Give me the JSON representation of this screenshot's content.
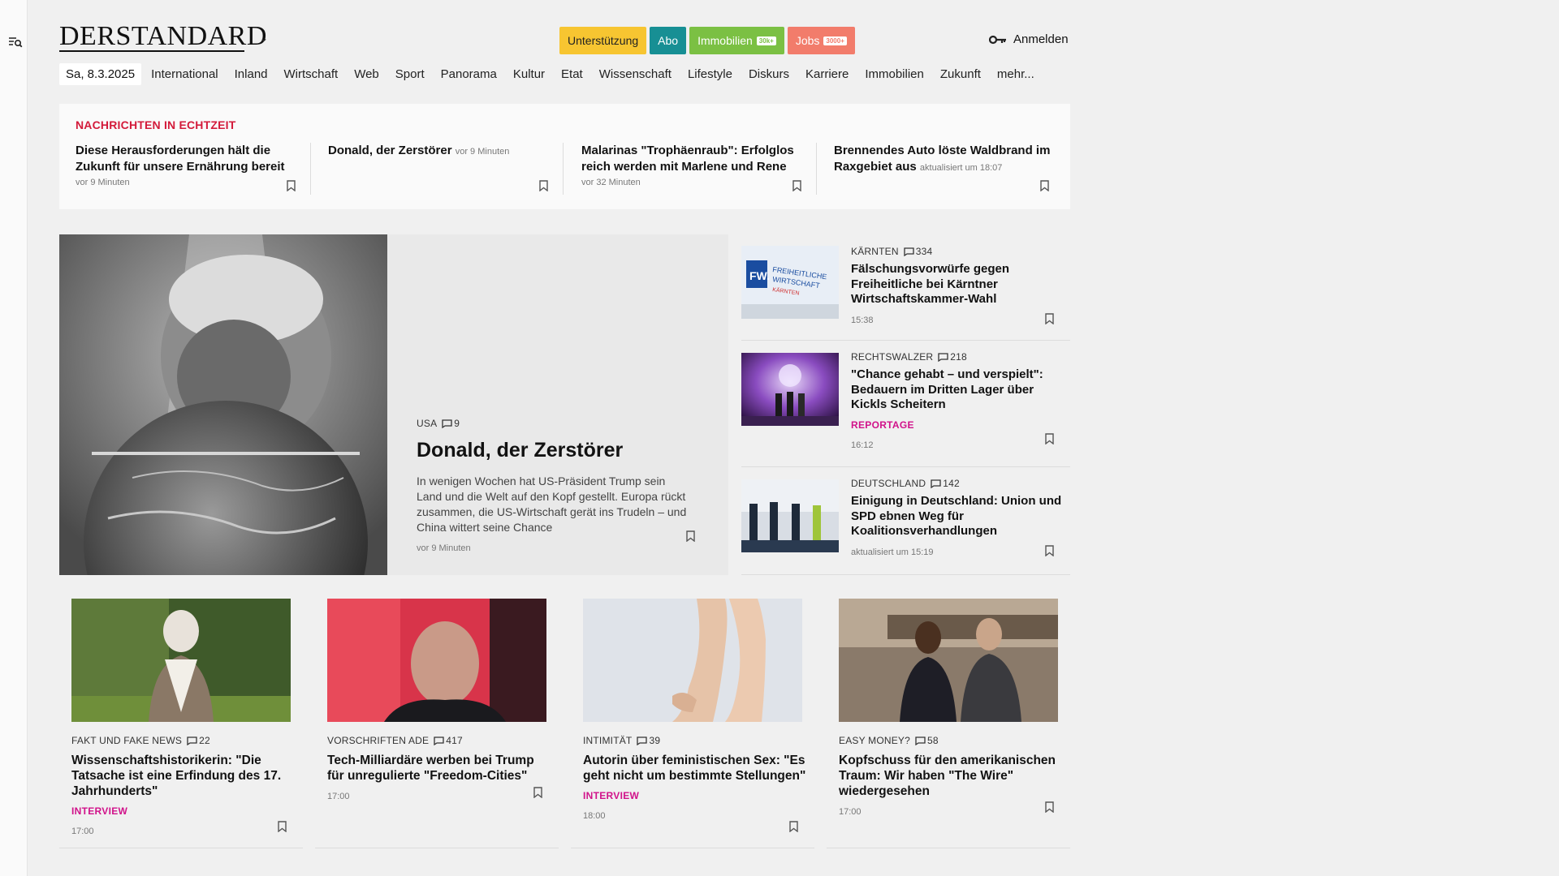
{
  "brand": {
    "logo": "DERSTANDARD"
  },
  "header": {
    "pills": [
      {
        "label": "Unterstützung",
        "tag": ""
      },
      {
        "label": "Abo",
        "tag": ""
      },
      {
        "label": "Immobilien",
        "tag": "30k+"
      },
      {
        "label": "Jobs",
        "tag": "3000+"
      }
    ],
    "login": "Anmelden",
    "colors": {
      "unterstuetzung": "#f7c531",
      "abo": "#178f94",
      "immobilien": "#7bc043",
      "jobs": "#f27c6b",
      "ticker_title": "#d31a3a",
      "label": "#d1128a"
    }
  },
  "nav": {
    "date": "Sa, 8.3.2025",
    "items": [
      "International",
      "Inland",
      "Wirtschaft",
      "Web",
      "Sport",
      "Panorama",
      "Kultur",
      "Etat",
      "Wissenschaft",
      "Lifestyle",
      "Diskurs",
      "Karriere",
      "Immobilien",
      "Zukunft",
      "mehr..."
    ]
  },
  "ticker": {
    "title": "NACHRICHTEN IN ECHTZEIT",
    "items": [
      {
        "title": "Diese Herausforderungen hält die Zukunft für unsere Ernährung bereit",
        "time": "vor 9 Minuten"
      },
      {
        "title": "Donald, der Zerstörer",
        "time": "vor 9 Minuten"
      },
      {
        "title": "Malarinas \"Trophäenraub\": Erfolglos reich werden mit Marlene und Rene",
        "time": "vor 32 Minuten"
      },
      {
        "title": "Brennendes Auto löste Waldbrand im Raxgebiet aus",
        "time": "aktualisiert um 18:07"
      }
    ]
  },
  "hero": {
    "kicker": "USA",
    "comments": "9",
    "title": "Donald, der Zerstörer",
    "lead": "In wenigen Wochen hat US-Präsident Trump sein Land und die Welt auf den Kopf gestellt. Europa rückt zusammen, die US-Wirtschaft gerät ins Trudeln – und China wittert seine Chance",
    "time": "vor 9 Minuten"
  },
  "side": [
    {
      "kicker": "KÄRNTEN",
      "comments": "334",
      "title": "Fälschungsvorwürfe gegen Freiheitliche bei Kärntner Wirtschaftskammer-Wahl",
      "label": "",
      "time": "15:38",
      "image_text": [
        "FREIHEITLICHE",
        "WIRTSCHAFT",
        "KÄRNTEN"
      ]
    },
    {
      "kicker": "RECHTSWALZER",
      "comments": "218",
      "title": "\"Chance gehabt – und verspielt\": Bedauern im Dritten Lager über Kickls Scheitern",
      "label": "REPORTAGE",
      "time": "16:12"
    },
    {
      "kicker": "DEUTSCHLAND",
      "comments": "142",
      "title": "Einigung in Deutschland: Union und SPD ebnen Weg für Koalitionsverhandlungen",
      "label": "",
      "time": "aktualisiert um 15:19"
    }
  ],
  "cards": [
    {
      "kicker": "FAKT UND FAKE NEWS",
      "comments": "22",
      "title": "Wissenschaftshistorikerin: \"Die Tatsache ist eine Erfindung des 17. Jahrhunderts\"",
      "label": "INTERVIEW",
      "time": "17:00"
    },
    {
      "kicker": "VORSCHRIFTEN ADE",
      "comments": "417",
      "title": "Tech-Milliardäre werben bei Trump für unregulierte \"Freedom-Cities\"",
      "label": "",
      "time": "17:00"
    },
    {
      "kicker": "INTIMITÄT",
      "comments": "39",
      "title": "Autorin über feministischen Sex: \"Es geht nicht um bestimmte Stellungen\"",
      "label": "INTERVIEW",
      "time": "18:00"
    },
    {
      "kicker": "EASY MONEY?",
      "comments": "58",
      "title": "Kopfschuss für den amerikanischen Traum: Wir haben \"The Wire\" wiedergesehen",
      "label": "",
      "time": "17:00"
    }
  ]
}
